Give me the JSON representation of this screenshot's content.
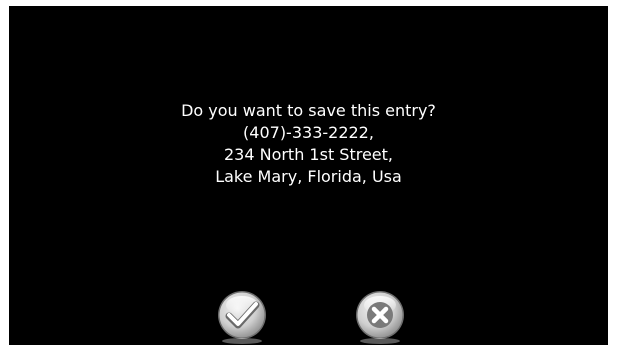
{
  "dialog": {
    "question": "Do you want to save this entry?",
    "phone": "(407)-333-2222,",
    "street": "234 North 1st Street,",
    "city_line": "Lake Mary, Florida, Usa"
  },
  "buttons": {
    "confirm_icon": "checkmark-icon",
    "cancel_icon": "x-icon"
  },
  "colors": {
    "background": "#000000",
    "text": "#ffffff",
    "button_face": "#d9d9d9"
  }
}
